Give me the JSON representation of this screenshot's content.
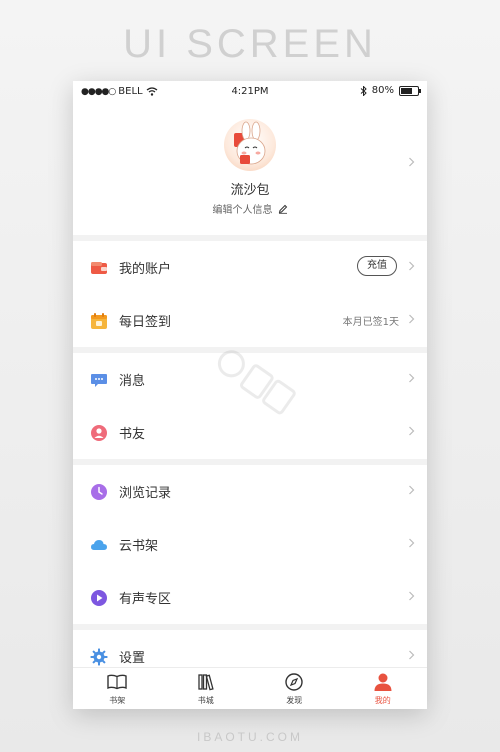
{
  "banner_title": "UI SCREEN",
  "footer_credit": "IBAOTU.COM",
  "status_bar": {
    "carrier": "BELL",
    "time": "4:21PM",
    "battery": "80%",
    "battery_level": 0.8
  },
  "profile": {
    "nickname": "流沙包",
    "edit_label": "编辑个人信息"
  },
  "menu": [
    {
      "label": "我的账户",
      "action": "充值",
      "icon": "wallet-icon"
    },
    {
      "label": "每日签到",
      "extra": "本月已签1天",
      "icon": "calendar-icon"
    },
    {
      "label": "消息",
      "icon": "message-icon"
    },
    {
      "label": "书友",
      "icon": "friend-icon"
    },
    {
      "label": "浏览记录",
      "icon": "history-clock-icon"
    },
    {
      "label": "云书架",
      "icon": "cloud-icon"
    },
    {
      "label": "有声专区",
      "icon": "play-icon"
    },
    {
      "label": "设置",
      "icon": "gear-icon"
    }
  ],
  "tabs": [
    {
      "label": "书架",
      "icon": "book-icon"
    },
    {
      "label": "书城",
      "icon": "library-icon"
    },
    {
      "label": "发现",
      "icon": "compass-icon"
    },
    {
      "label": "我的",
      "icon": "user-icon",
      "active": true
    }
  ],
  "colors": {
    "accent": "#e8523f",
    "separator": "#f2f2f2"
  }
}
